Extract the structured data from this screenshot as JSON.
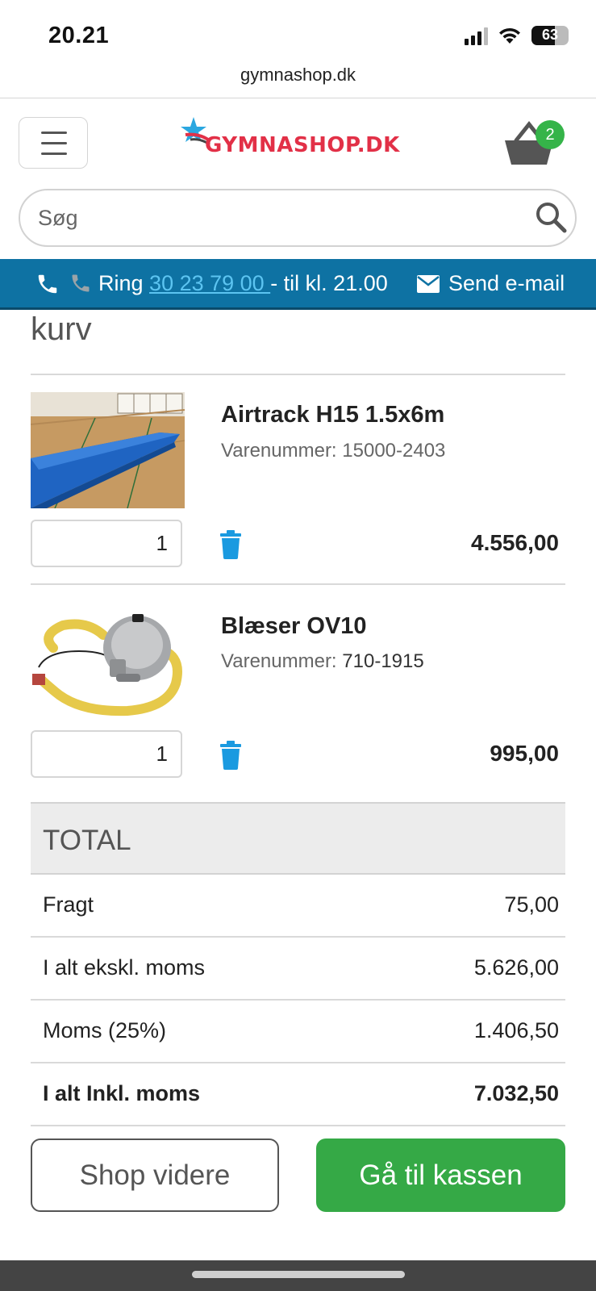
{
  "status_bar": {
    "time": "20.21",
    "battery": "63",
    "battery_level": 0.63
  },
  "browser": {
    "url": "gymnashop.dk"
  },
  "header": {
    "logo_text": "GYMNASHOP.DK",
    "cart_count": "2",
    "brand_color": "#e23047",
    "badge_color": "#35b449"
  },
  "search": {
    "placeholder": "Søg"
  },
  "contact_bar": {
    "ring_label": "Ring",
    "phone": "30 23 79 00 ",
    "hours": "- til kl. 21.00",
    "email_label": "Send e-mail",
    "bar_color": "#0e72a3"
  },
  "cart": {
    "heading": "kurv",
    "items": [
      {
        "name": "Airtrack H15 1.5x6m",
        "sku_label": "Varenummer:",
        "sku": "15000-2403",
        "qty": "1",
        "price": "4.556,00",
        "image_icon": "airtrack-mat-image"
      },
      {
        "name": "Blæser OV10",
        "sku_label": "Varenummer:",
        "sku": "710-1915",
        "qty": "1",
        "price": "995,00",
        "image_icon": "air-blower-image"
      }
    ]
  },
  "totals": {
    "heading": "TOTAL",
    "rows": [
      {
        "label": "Fragt",
        "value": "75,00"
      },
      {
        "label": "I alt ekskl. moms",
        "value": "5.626,00"
      },
      {
        "label": "Moms (25%)",
        "value": "1.406,50"
      },
      {
        "label": "I alt Inkl. moms",
        "value": "7.032,50"
      }
    ]
  },
  "actions": {
    "continue_label": "Shop videre",
    "checkout_label": "Gå til kassen",
    "checkout_color": "#35a946"
  }
}
